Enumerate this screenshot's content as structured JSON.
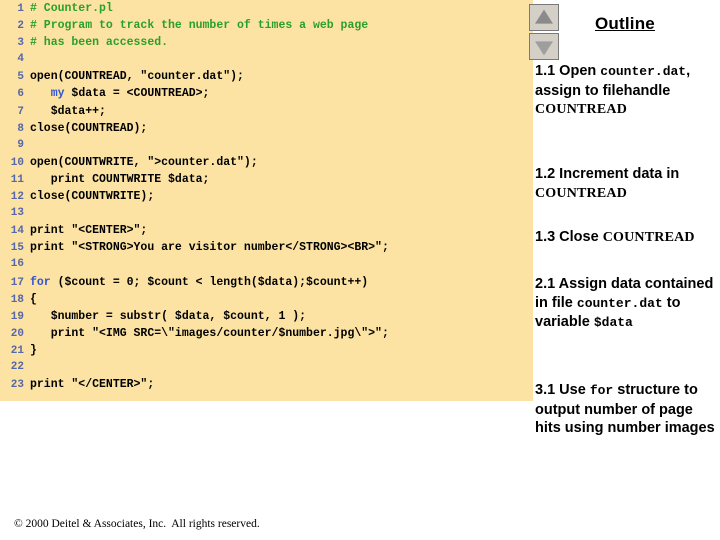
{
  "code_panel": {
    "language": "perl",
    "background_color": "#fce3a3",
    "lines": [
      {
        "number": "1",
        "tokens": [
          {
            "text": "# Counter.pl",
            "type": "comment"
          }
        ]
      },
      {
        "number": "2",
        "tokens": [
          {
            "text": "# Program to track the number of times a web page",
            "type": "comment"
          }
        ]
      },
      {
        "number": "3",
        "tokens": [
          {
            "text": "# has been accessed.",
            "type": "comment"
          }
        ]
      },
      {
        "number": "4",
        "tokens": [
          {
            "text": "",
            "type": "plain"
          }
        ]
      },
      {
        "number": "5",
        "tokens": [
          {
            "text": "open(COUNTREAD, \"counter.dat\");",
            "type": "plain"
          }
        ]
      },
      {
        "number": "6",
        "tokens": [
          {
            "text": "   ",
            "type": "plain"
          },
          {
            "text": "my",
            "type": "keyword"
          },
          {
            "text": " $data = <COUNTREAD>;",
            "type": "plain"
          }
        ]
      },
      {
        "number": "7",
        "tokens": [
          {
            "text": "   $data++;",
            "type": "plain"
          }
        ]
      },
      {
        "number": "8",
        "tokens": [
          {
            "text": "close(COUNTREAD);",
            "type": "plain"
          }
        ]
      },
      {
        "number": "9",
        "tokens": [
          {
            "text": "",
            "type": "plain"
          }
        ]
      },
      {
        "number": "10",
        "tokens": [
          {
            "text": "open(COUNTWRITE, \">counter.dat\");",
            "type": "plain"
          }
        ]
      },
      {
        "number": "11",
        "tokens": [
          {
            "text": "   print COUNTWRITE $data;",
            "type": "plain"
          }
        ]
      },
      {
        "number": "12",
        "tokens": [
          {
            "text": "close(COUNTWRITE);",
            "type": "plain"
          }
        ]
      },
      {
        "number": "13",
        "tokens": [
          {
            "text": "",
            "type": "plain"
          }
        ]
      },
      {
        "number": "14",
        "tokens": [
          {
            "text": "print \"<CENTER>\";",
            "type": "plain"
          }
        ]
      },
      {
        "number": "15",
        "tokens": [
          {
            "text": "print \"<STRONG>You are visitor number</STRONG><BR>\";",
            "type": "plain"
          }
        ]
      },
      {
        "number": "16",
        "tokens": [
          {
            "text": "",
            "type": "plain"
          }
        ]
      },
      {
        "number": "17",
        "tokens": [
          {
            "text": "",
            "type": "plain"
          },
          {
            "text": "for",
            "type": "keyword"
          },
          {
            "text": " ($count = 0; $count < length($data);$count++)",
            "type": "plain"
          }
        ]
      },
      {
        "number": "18",
        "tokens": [
          {
            "text": "{",
            "type": "plain"
          }
        ]
      },
      {
        "number": "19",
        "tokens": [
          {
            "text": "   $number = substr( $data, $count, 1 );",
            "type": "plain"
          }
        ]
      },
      {
        "number": "20",
        "tokens": [
          {
            "text": "   print \"<IMG SRC=\\\"images/counter/$number.jpg\\\">\";",
            "type": "plain"
          }
        ]
      },
      {
        "number": "21",
        "tokens": [
          {
            "text": "}",
            "type": "plain"
          }
        ]
      },
      {
        "number": "22",
        "tokens": [
          {
            "text": "",
            "type": "plain"
          }
        ]
      },
      {
        "number": "23",
        "tokens": [
          {
            "text": "print \"</CENTER>\";",
            "type": "plain"
          }
        ]
      }
    ]
  },
  "outline": {
    "title": "Outline",
    "scroll_up_label": "scroll-up",
    "scroll_down_label": "scroll-down",
    "items": [
      {
        "id": "1.1",
        "parts": [
          {
            "text": "1.1 Open ",
            "style": "prose"
          },
          {
            "text": "counter.dat",
            "style": "mono"
          },
          {
            "text": ", assign to filehandle ",
            "style": "prose"
          },
          {
            "text": "COUNTREAD",
            "style": "smallcaps"
          }
        ]
      },
      {
        "id": "1.2",
        "parts": [
          {
            "text": "1.2 Increment data in ",
            "style": "prose"
          },
          {
            "text": "COUNTREAD",
            "style": "smallcaps"
          }
        ]
      },
      {
        "id": "1.3",
        "parts": [
          {
            "text": "1.3 Close ",
            "style": "prose"
          },
          {
            "text": "COUNTREAD",
            "style": "smallcaps"
          }
        ]
      },
      {
        "id": "2.1",
        "parts": [
          {
            "text": "2.1 Assign data contained in file ",
            "style": "prose"
          },
          {
            "text": "counter.dat",
            "style": "mono"
          },
          {
            "text": " to variable ",
            "style": "prose"
          },
          {
            "text": "$data",
            "style": "mono"
          }
        ]
      },
      {
        "id": "3.1",
        "parts": [
          {
            "text": "3.1 Use ",
            "style": "prose"
          },
          {
            "text": "for",
            "style": "mono"
          },
          {
            "text": " structure to output number of page hits using number images",
            "style": "prose"
          }
        ]
      }
    ]
  },
  "footer": {
    "copyright": "© 2000 Deitel & Associates, Inc.  All rights reserved."
  },
  "colors": {
    "code_background": "#fce3a3",
    "comment": "#2aa02a",
    "keyword": "#3355cc",
    "line_number": "#5566aa",
    "panel_background": "#ffffff"
  }
}
